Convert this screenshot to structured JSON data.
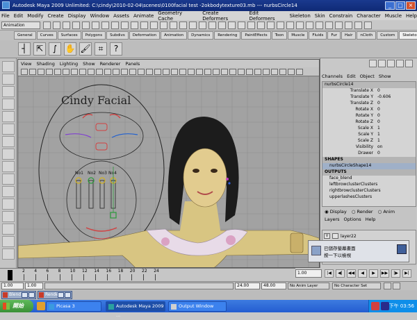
{
  "window": {
    "title": "Autodesk Maya 2009 Unlimited: C:\\cindy\\2010-02-04\\scenes\\0100facial test -2okbodytexture03.mb  ---  nurbsCircle14",
    "minimize": "_",
    "maximize": "□",
    "close": "×"
  },
  "menubar": [
    "File",
    "Edit",
    "Modify",
    "Create",
    "Display",
    "Window",
    "Assets",
    "Animate",
    "Geometry Cache",
    "Create Deformers",
    "Edit Deformers",
    "Skeleton",
    "Skin",
    "Constrain",
    "Character",
    "Muscle",
    "Help"
  ],
  "statusline": {
    "mode": "Animation"
  },
  "shelf": {
    "tabs": [
      "General",
      "Curves",
      "Surfaces",
      "Polygons",
      "Subdivs",
      "Deformation",
      "Animation",
      "Dynamics",
      "Rendering",
      "PaintEffects",
      "Toon",
      "Muscle",
      "Fluids",
      "Fur",
      "Hair",
      "nCloth",
      "Custom",
      "Skeleton"
    ],
    "active_tab": "Skeleton",
    "icons": [
      "joint-icon",
      "ik-handle-icon",
      "ik-spline-icon",
      "bind-skin-icon",
      "paint-weights-icon",
      "lattice-icon",
      "help-icon"
    ]
  },
  "viewport": {
    "menu": [
      "View",
      "Shading",
      "Lighting",
      "Show",
      "Renderer",
      "Panels"
    ],
    "title_text": "Cindy Facial",
    "slider_labels": [
      "No1",
      "No2",
      "No3",
      "No4"
    ]
  },
  "channelbox": {
    "menu": [
      "Channels",
      "Edit",
      "Object",
      "Show"
    ],
    "object": "nurbsCircle14",
    "attributes": [
      {
        "name": "Translate X",
        "value": "0"
      },
      {
        "name": "Translate Y",
        "value": "-0.606"
      },
      {
        "name": "Translate Z",
        "value": "0"
      },
      {
        "name": "Rotate X",
        "value": "0"
      },
      {
        "name": "Rotate Y",
        "value": "0"
      },
      {
        "name": "Rotate Z",
        "value": "0"
      },
      {
        "name": "Scale X",
        "value": "1"
      },
      {
        "name": "Scale Y",
        "value": "1"
      },
      {
        "name": "Scale Z",
        "value": "1"
      },
      {
        "name": "Visibility",
        "value": "on"
      },
      {
        "name": "Drawer",
        "value": "0"
      }
    ],
    "shapes_header": "SHAPES",
    "shape": "nurbsCircleShape14",
    "outputs_header": "OUTPUTS",
    "outputs": [
      "face_blend",
      "leftbrowclusterClusters",
      "rightbrowclusterClusters",
      "upperlashesClusters"
    ]
  },
  "layer_editor": {
    "radio": [
      "Display",
      "Render",
      "Anim"
    ],
    "menu": [
      "Layers",
      "Options",
      "Help"
    ],
    "layer_name": "layer22"
  },
  "timeslider": {
    "ticks": [
      "2",
      "4",
      "6",
      "8",
      "10",
      "12",
      "14",
      "16",
      "18",
      "20",
      "22",
      "24"
    ],
    "current_frame": "1.00"
  },
  "rangeslider": {
    "start": "1.00",
    "inner_start": "1.00",
    "inner_end": "24.00",
    "end": "48.00",
    "anim_layer": "No Anim Layer",
    "character_set": "No Character Set"
  },
  "minimized": [
    "Blend S...",
    "Render ..."
  ],
  "notification": {
    "line1": "已儲存螢幕畫面",
    "line2": "按一下以檢視"
  },
  "taskbar": {
    "start": "開始",
    "tasks": [
      "Picasa 3",
      "Autodesk Maya 2009 ...",
      "Output Window"
    ],
    "clock": "下午 03:56"
  },
  "colors": {
    "title_bar": "#0f2a76",
    "taskbar": "#245dd1",
    "viewport_bg": "#a2a2a2",
    "start_button": "#3a9036"
  }
}
